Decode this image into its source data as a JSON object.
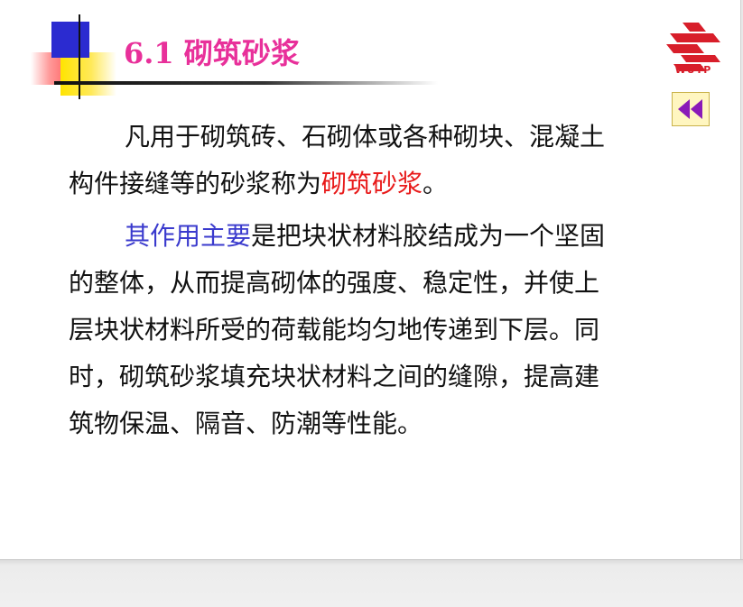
{
  "slide": {
    "title": "6.1 砌筑砂浆",
    "logo_text": "WUTP",
    "paragraph1": {
      "line1": "凡用于砌筑砖、石砌体或各种砌块、混凝土",
      "line2_start": "构件接缝等的砂浆称为",
      "line2_highlight": "砌筑砂浆",
      "line2_end": "。"
    },
    "paragraph2": {
      "line1_highlight": "其作用主要",
      "line1_rest": "是把块状材料胶结成为一个坚固",
      "line2": "的整体，从而提高砌体的强度、稳定性，并使上",
      "line3": "层块状材料所受的荷载能均匀地传递到下层。同",
      "line4": "时，砌筑砂浆填充块状材料之间的缝隙，提高建",
      "line5": "筑物保温、隔音、防潮等性能。"
    }
  },
  "icons": {
    "back": "double-chevron-left-icon",
    "logo": "wutp-logo-icon"
  },
  "colors": {
    "title": "#e8309a",
    "highlight_red": "#e81a1a",
    "highlight_blue": "#3a3acd",
    "deco_blue": "#2b2bd0",
    "deco_yellow": "#ffe400",
    "deco_red": "#ff5a5a",
    "back_icon": "#8a1ab8"
  }
}
